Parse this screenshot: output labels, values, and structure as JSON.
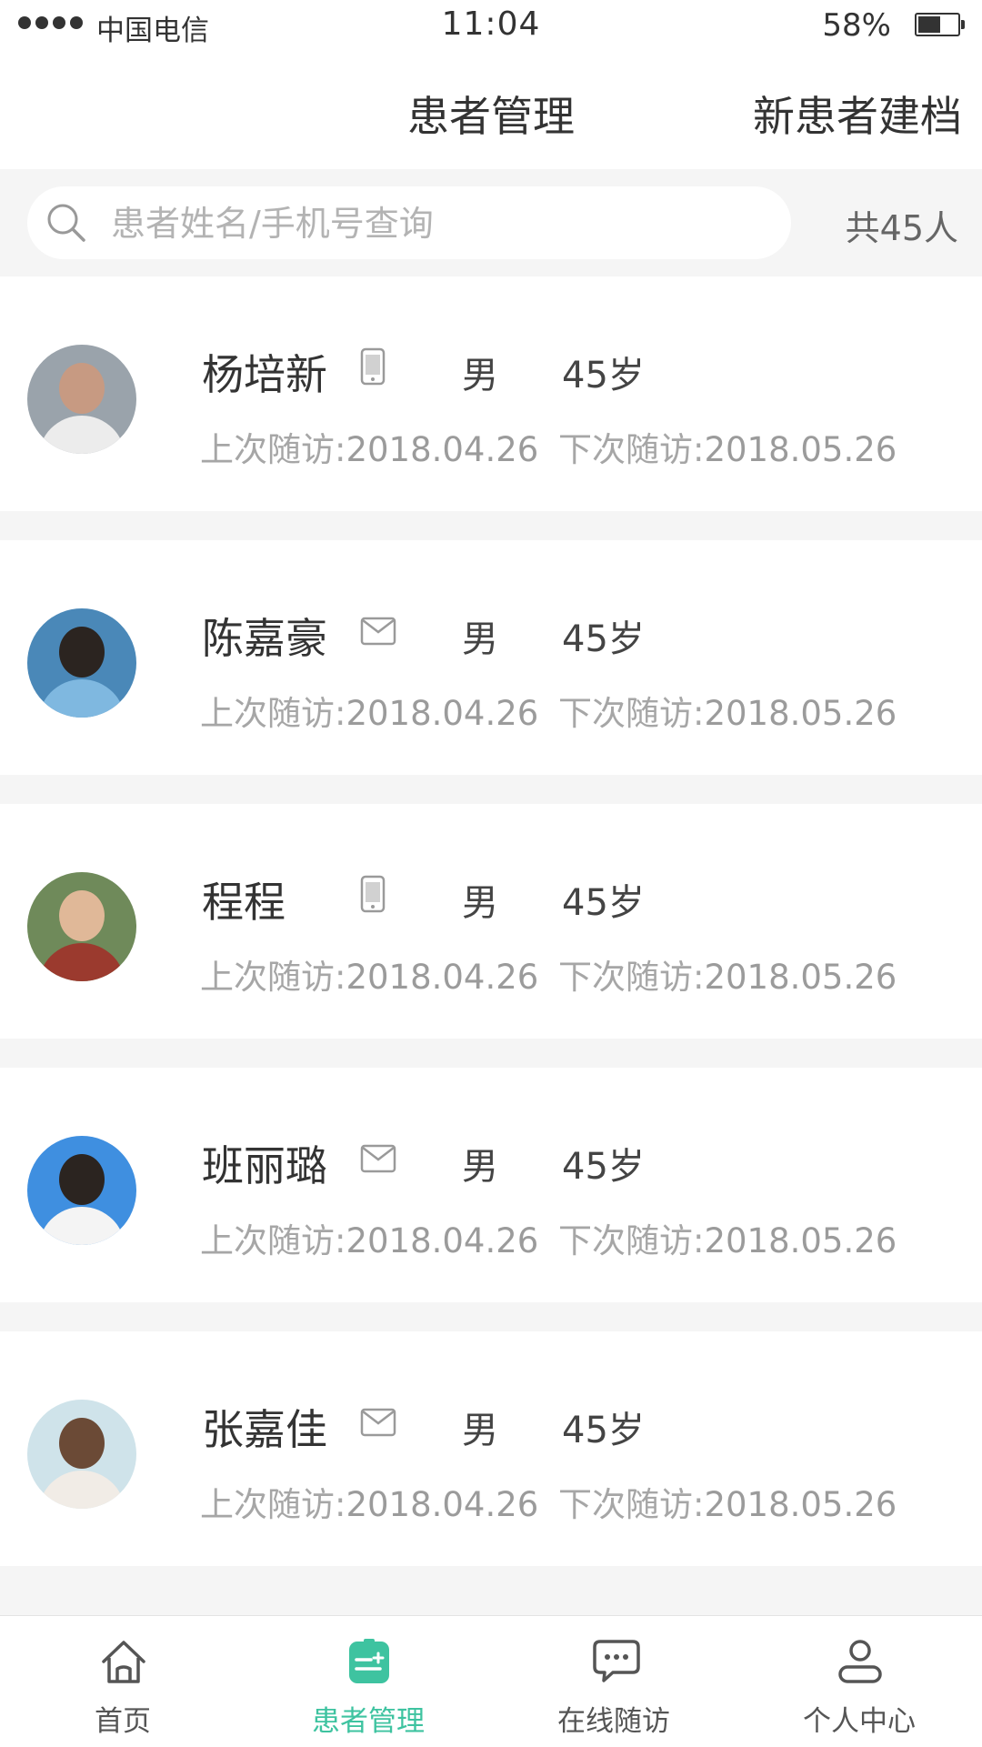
{
  "status_bar": {
    "carrier": "中国电信",
    "time": "11:04",
    "battery_percent": "58%",
    "battery_level": 0.58
  },
  "header": {
    "title": "患者管理",
    "action_label": "新患者建档"
  },
  "search": {
    "placeholder": "患者姓名/手机号查询",
    "value": "",
    "total_label": "共45人"
  },
  "colors": {
    "accent": "#3ec3a0",
    "text_primary": "#333333",
    "text_secondary": "#a6a6a6",
    "background": "#f5f5f5"
  },
  "patients": [
    {
      "name": "杨培新",
      "contact_icon": "phone-icon",
      "gender": "男",
      "age": "45岁",
      "last_visit_label": "上次随访:",
      "last_visit_date": "2018.04.26",
      "next_visit_label": "下次随访:",
      "next_visit_date": "2018.05.26"
    },
    {
      "name": "陈嘉豪",
      "contact_icon": "mail-icon",
      "gender": "男",
      "age": "45岁",
      "last_visit_label": "上次随访:",
      "last_visit_date": "2018.04.26",
      "next_visit_label": "下次随访:",
      "next_visit_date": "2018.05.26"
    },
    {
      "name": "程程",
      "contact_icon": "phone-icon",
      "gender": "男",
      "age": "45岁",
      "last_visit_label": "上次随访:",
      "last_visit_date": "2018.04.26",
      "next_visit_label": "下次随访:",
      "next_visit_date": "2018.05.26"
    },
    {
      "name": "班丽璐",
      "contact_icon": "mail-icon",
      "gender": "男",
      "age": "45岁",
      "last_visit_label": "上次随访:",
      "last_visit_date": "2018.04.26",
      "next_visit_label": "下次随访:",
      "next_visit_date": "2018.05.26"
    },
    {
      "name": "张嘉佳",
      "contact_icon": "mail-icon",
      "gender": "男",
      "age": "45岁",
      "last_visit_label": "上次随访:",
      "last_visit_date": "2018.04.26",
      "next_visit_label": "下次随访:",
      "next_visit_date": "2018.05.26"
    }
  ],
  "tab_bar": [
    {
      "label": "首页",
      "icon": "home-icon",
      "active": false
    },
    {
      "label": "患者管理",
      "icon": "patient-management-icon",
      "active": true
    },
    {
      "label": "在线随访",
      "icon": "chat-bubble-icon",
      "active": false
    },
    {
      "label": "个人中心",
      "icon": "user-icon",
      "active": false
    }
  ]
}
